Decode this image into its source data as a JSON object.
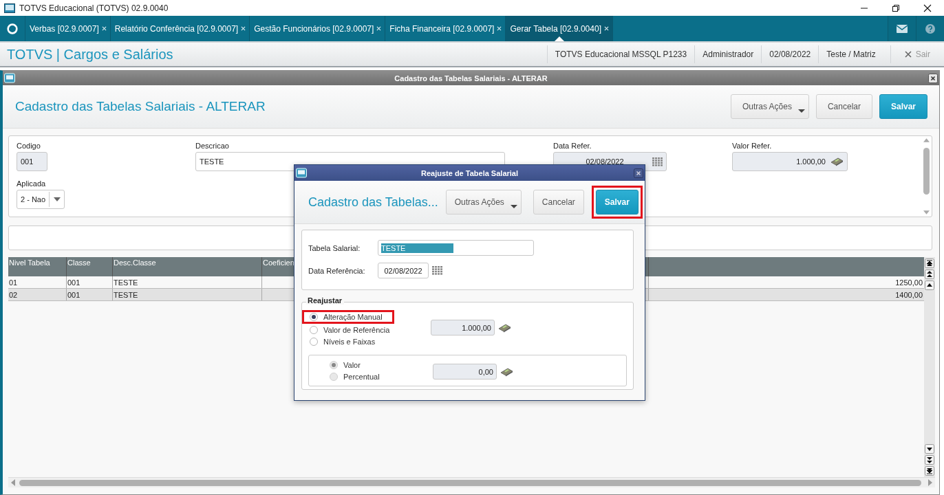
{
  "window": {
    "title": "TOTVS Educacional (TOTVS) 02.9.0040"
  },
  "tabs": [
    {
      "label": "Verbas [02.9.0007]",
      "selected": false
    },
    {
      "label": "Relatório Conferência [02.9.0007]",
      "selected": false
    },
    {
      "label": "Gestão Funcionários [02.9.0007]",
      "selected": false
    },
    {
      "label": "Ficha Financeira [02.9.0007]",
      "selected": false
    },
    {
      "label": "Gerar Tabela [02.9.0040]",
      "selected": true
    }
  ],
  "header": {
    "app_title": "TOTVS | Cargos e Salários",
    "info": [
      "TOTVS Educacional MSSQL P1233",
      "Administrador",
      "02/08/2022",
      "Teste / Matriz"
    ],
    "exit": "Sair"
  },
  "form_window": {
    "title": "Cadastro das Tabelas Salariais - ALTERAR",
    "heading": "Cadastro das Tabelas Salariais - ALTERAR",
    "buttons": [
      {
        "label": "Outras Ações",
        "kind": "menu"
      },
      {
        "label": "Cancelar",
        "kind": "default"
      },
      {
        "label": "Salvar",
        "kind": "primary"
      }
    ],
    "codigo": {
      "label": "Codigo",
      "value": "001"
    },
    "descricao": {
      "label": "Descricao",
      "value": "TESTE"
    },
    "data_refer": {
      "label": "Data Refer.",
      "value": "02/08/2022"
    },
    "valor_refer": {
      "label": "Valor Refer.",
      "value": "1.000,00"
    },
    "aplicada": {
      "label": "Aplicada",
      "value": "2 - Nao"
    }
  },
  "grid": {
    "columns": [
      "Nivel Tabela",
      "Classe",
      "Desc.Classe",
      "Coeficien"
    ],
    "rows": [
      {
        "nivel": "01",
        "classe": "001",
        "desc": "TESTE",
        "column_5": "1250,00",
        "selected": false
      },
      {
        "nivel": "02",
        "classe": "001",
        "desc": "TESTE",
        "column_5": "1400,00",
        "selected": true
      }
    ]
  },
  "dialog": {
    "title": "Reajuste de Tabela Salarial",
    "heading": "Cadastro das Tabelas...",
    "buttons": [
      {
        "label": "Outras Ações",
        "kind": "menu",
        "highlighted": false
      },
      {
        "label": "Cancelar",
        "kind": "default",
        "highlighted": false
      },
      {
        "label": "Salvar",
        "kind": "primary",
        "highlighted": true
      }
    ],
    "tabela_salarial": {
      "label": "Tabela Salarial:",
      "value": "TESTE"
    },
    "data_referencia": {
      "label": "Data Referência:",
      "value": "02/08/2022"
    },
    "reajustar": {
      "title": "Reajustar",
      "options": [
        {
          "label": "Alteração Manual",
          "selected": true,
          "highlighted": true
        },
        {
          "label": "Valor de Referência",
          "selected": false,
          "highlighted": false
        },
        {
          "label": "Níveis e Faixas",
          "selected": false,
          "highlighted": false
        }
      ],
      "valor_referencia": "1.000,00",
      "sub_options": [
        {
          "label": "Valor",
          "selected": true,
          "disabled": true
        },
        {
          "label": "Percentual",
          "selected": false,
          "disabled": true
        }
      ],
      "sub_value": "0,00"
    }
  }
}
